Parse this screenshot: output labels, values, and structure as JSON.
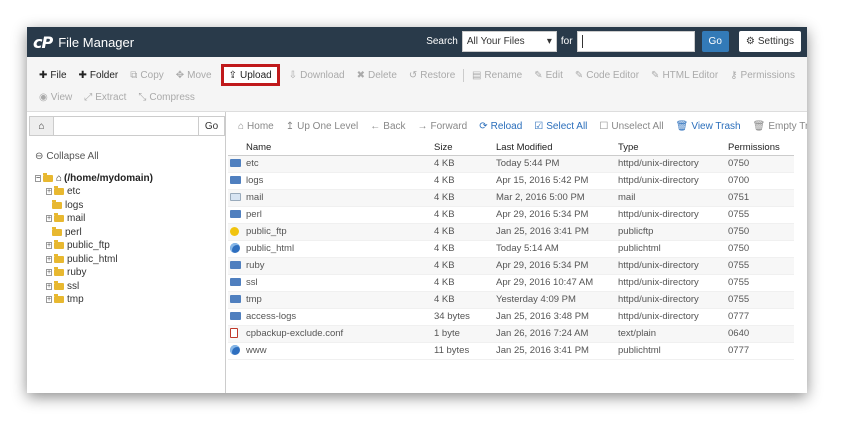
{
  "header": {
    "logo": "cP",
    "title": "File Manager",
    "search_label": "Search",
    "search_scope": "All Your Files",
    "for_label": "for",
    "search_value": "",
    "go_label": "Go",
    "settings_label": "Settings"
  },
  "toolbar": {
    "row1": [
      {
        "name": "file-button",
        "icon": "plus",
        "label": "File",
        "active": true
      },
      {
        "name": "folder-button",
        "icon": "plus",
        "label": "Folder",
        "active": true
      },
      {
        "name": "copy-button",
        "icon": "copy",
        "label": "Copy",
        "active": false
      },
      {
        "name": "move-button",
        "icon": "move",
        "label": "Move",
        "active": false
      },
      {
        "name": "upload-button",
        "icon": "upload",
        "label": "Upload",
        "active": true,
        "highlight": true
      },
      {
        "name": "download-button",
        "icon": "download",
        "label": "Download",
        "active": false
      },
      {
        "name": "delete-button",
        "icon": "x",
        "label": "Delete",
        "active": false
      },
      {
        "name": "restore-button",
        "icon": "restore",
        "label": "Restore",
        "active": false
      },
      {
        "name": "rename-button",
        "icon": "rename",
        "label": "Rename",
        "active": false
      },
      {
        "name": "edit-button",
        "icon": "pencil",
        "label": "Edit",
        "active": false
      },
      {
        "name": "code-editor-button",
        "icon": "pencil-square",
        "label": "Code Editor",
        "active": false
      },
      {
        "name": "html-editor-button",
        "icon": "pencil-square",
        "label": "HTML Editor",
        "active": false
      },
      {
        "name": "permissions-button",
        "icon": "key",
        "label": "Permissions",
        "active": false
      }
    ],
    "row2": [
      {
        "name": "view-button",
        "icon": "eye",
        "label": "View",
        "active": false
      },
      {
        "name": "extract-button",
        "icon": "expand",
        "label": "Extract",
        "active": false
      },
      {
        "name": "compress-button",
        "icon": "compress",
        "label": "Compress",
        "active": false
      }
    ]
  },
  "left": {
    "path_value": "",
    "go_label": "Go",
    "collapse_label": "Collapse All",
    "root_label": "(/home/mydomain)",
    "tree": [
      {
        "label": "etc",
        "expandable": true
      },
      {
        "label": "logs",
        "expandable": false
      },
      {
        "label": "mail",
        "expandable": true
      },
      {
        "label": "perl",
        "expandable": false
      },
      {
        "label": "public_ftp",
        "expandable": true
      },
      {
        "label": "public_html",
        "expandable": true
      },
      {
        "label": "ruby",
        "expandable": true
      },
      {
        "label": "ssl",
        "expandable": true
      },
      {
        "label": "tmp",
        "expandable": true
      }
    ]
  },
  "nav": [
    {
      "name": "home-nav",
      "icon": "home",
      "label": "Home",
      "blue": false
    },
    {
      "name": "up-one-level-nav",
      "icon": "level-up",
      "label": "Up One Level",
      "blue": false
    },
    {
      "name": "back-nav",
      "icon": "arrow-left",
      "label": "Back",
      "blue": false
    },
    {
      "name": "forward-nav",
      "icon": "arrow-right",
      "label": "Forward",
      "blue": false
    },
    {
      "name": "reload-nav",
      "icon": "refresh",
      "label": "Reload",
      "blue": true
    },
    {
      "name": "select-all-nav",
      "icon": "check-square",
      "label": "Select All",
      "blue": true
    },
    {
      "name": "unselect-all-nav",
      "icon": "square",
      "label": "Unselect All",
      "blue": false
    },
    {
      "name": "view-trash-nav",
      "icon": "trash",
      "label": "View Trash",
      "blue": true
    },
    {
      "name": "empty-trash-nav",
      "icon": "trash",
      "label": "Empty Trash",
      "blue": false
    }
  ],
  "table": {
    "columns": [
      "Name",
      "Size",
      "Last Modified",
      "Type",
      "Permissions"
    ],
    "rows": [
      {
        "icon": "dir",
        "name": "etc",
        "size": "4 KB",
        "modified": "Today 5:44 PM",
        "type": "httpd/unix-directory",
        "perms": "0750"
      },
      {
        "icon": "dir",
        "name": "logs",
        "size": "4 KB",
        "modified": "Apr 15, 2016 5:42 PM",
        "type": "httpd/unix-directory",
        "perms": "0700"
      },
      {
        "icon": "mail",
        "name": "mail",
        "size": "4 KB",
        "modified": "Mar 2, 2016 5:00 PM",
        "type": "mail",
        "perms": "0751"
      },
      {
        "icon": "dir",
        "name": "perl",
        "size": "4 KB",
        "modified": "Apr 29, 2016 5:34 PM",
        "type": "httpd/unix-directory",
        "perms": "0755"
      },
      {
        "icon": "ftp",
        "name": "public_ftp",
        "size": "4 KB",
        "modified": "Jan 25, 2016 3:41 PM",
        "type": "publicftp",
        "perms": "0750"
      },
      {
        "icon": "html",
        "name": "public_html",
        "size": "4 KB",
        "modified": "Today 5:14 AM",
        "type": "publichtml",
        "perms": "0750"
      },
      {
        "icon": "dir",
        "name": "ruby",
        "size": "4 KB",
        "modified": "Apr 29, 2016 5:34 PM",
        "type": "httpd/unix-directory",
        "perms": "0755"
      },
      {
        "icon": "dir",
        "name": "ssl",
        "size": "4 KB",
        "modified": "Apr 29, 2016 10:47 AM",
        "type": "httpd/unix-directory",
        "perms": "0755"
      },
      {
        "icon": "dir",
        "name": "tmp",
        "size": "4 KB",
        "modified": "Yesterday 4:09 PM",
        "type": "httpd/unix-directory",
        "perms": "0755"
      },
      {
        "icon": "dir",
        "name": "access-logs",
        "size": "34 bytes",
        "modified": "Jan 25, 2016 3:48 PM",
        "type": "httpd/unix-directory",
        "perms": "0777"
      },
      {
        "icon": "text",
        "name": "cpbackup-exclude.conf",
        "size": "1 byte",
        "modified": "Jan 26, 2016 7:24 AM",
        "type": "text/plain",
        "perms": "0640"
      },
      {
        "icon": "html",
        "name": "www",
        "size": "11 bytes",
        "modified": "Jan 25, 2016 3:41 PM",
        "type": "publichtml",
        "perms": "0777"
      }
    ]
  },
  "colors": {
    "header_bg": "#293a4a",
    "primary_blue": "#337ab7",
    "upload_highlight": "#c0191b",
    "folder_yellow": "#e8b830"
  }
}
